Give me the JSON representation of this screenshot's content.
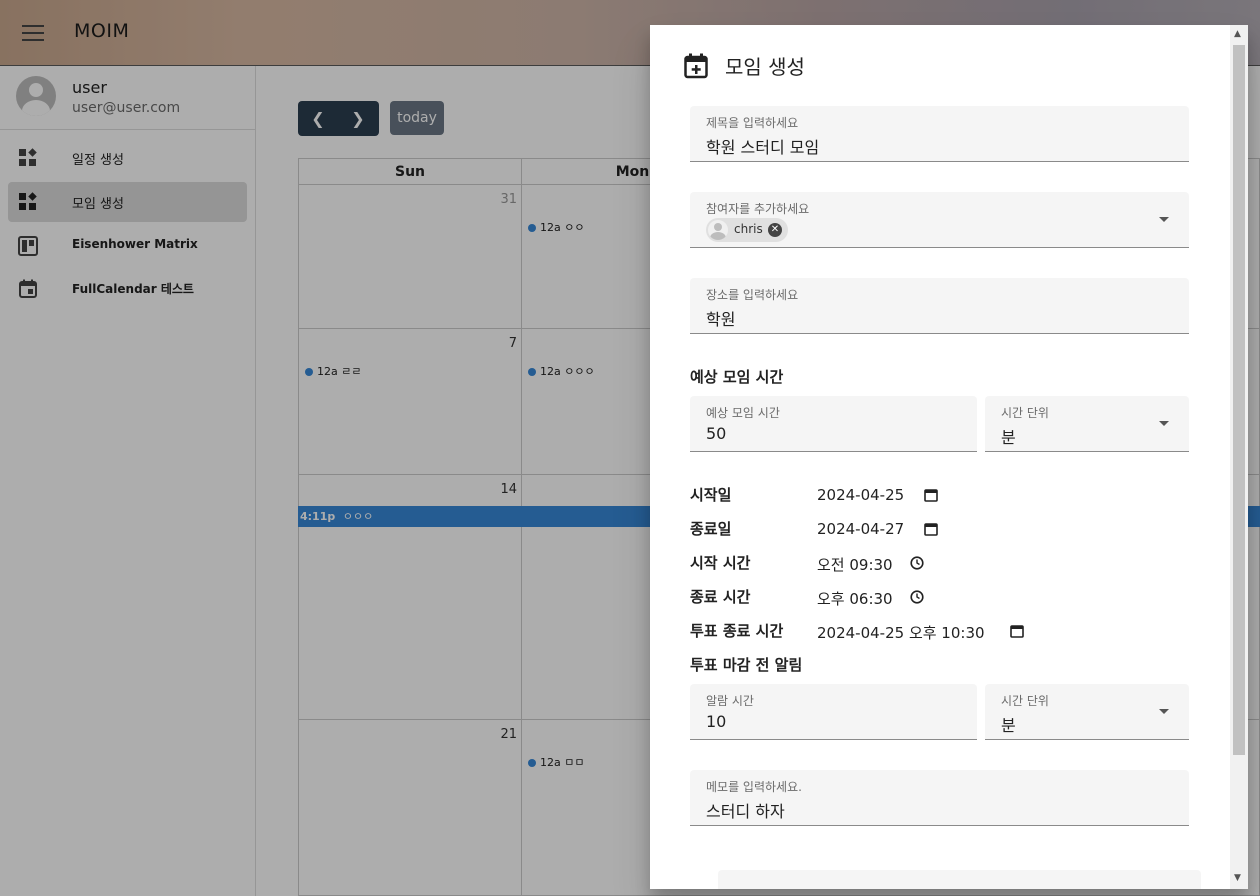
{
  "app": {
    "title": "MOIM"
  },
  "user": {
    "name": "user",
    "email": "user@user.com"
  },
  "sidebar": {
    "items": [
      {
        "label": "일정 생성"
      },
      {
        "label": "모임 생성"
      },
      {
        "label": "Eisenhower Matrix"
      },
      {
        "label": "FullCalendar 테스트"
      }
    ]
  },
  "calendar": {
    "today_label": "today",
    "headers": [
      "Sun",
      "Mon"
    ],
    "day_numbers": [
      "31",
      "7",
      "14",
      "21"
    ],
    "events": [
      "12a ㅇㅇ",
      "12a ㄹㄹ",
      "12a ㅇㅇㅇ",
      "12a ㅁㅁ"
    ],
    "bar_event": {
      "time": "4:11p",
      "title": "ㅇㅇㅇ"
    }
  },
  "dialog": {
    "title": "모임 생성",
    "title_field": {
      "label": "제목을 입력하세요",
      "value": "학원 스터디 모임"
    },
    "participants_field": {
      "label": "참여자를 추가하세요",
      "chip": "chris"
    },
    "location_field": {
      "label": "장소를 입력하세요",
      "value": "학원"
    },
    "duration_section": "예상 모임 시간",
    "duration_field": {
      "label": "예상 모임 시간",
      "value": "50"
    },
    "duration_unit": {
      "label": "시간 단위",
      "value": "분"
    },
    "start_date": {
      "label": "시작일",
      "value": "2024-04-25"
    },
    "end_date": {
      "label": "종료일",
      "value": "2024-04-27"
    },
    "start_time": {
      "label": "시작 시간",
      "value": "오전 09:30"
    },
    "end_time": {
      "label": "종료 시간",
      "value": "오후 06:30"
    },
    "vote_end": {
      "label": "투표 종료 시간",
      "value": "2024-04-25 오후 10:30"
    },
    "alarm_section": "투표 마감 전 알림",
    "alarm_field": {
      "label": "알람 시간",
      "value": "10"
    },
    "alarm_unit": {
      "label": "시간 단위",
      "value": "분"
    },
    "memo_field": {
      "label": "메모를 입력하세요.",
      "value": "스터디 하자"
    }
  },
  "colors": {
    "event_blue": "#3788d8",
    "nav_dark": "#2c3e50"
  }
}
